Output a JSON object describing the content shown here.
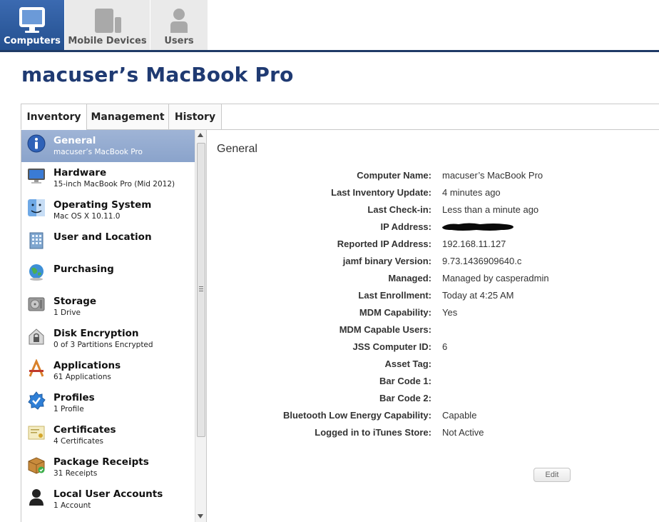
{
  "topnav": {
    "tabs": [
      {
        "label": "Computers",
        "icon": "monitor-icon",
        "active": true
      },
      {
        "label": "Mobile Devices",
        "icon": "mobile-devices-icon",
        "active": false
      },
      {
        "label": "Users",
        "icon": "user-icon",
        "active": false
      }
    ]
  },
  "page_title": "macuser’s MacBook Pro",
  "tabs": [
    {
      "label": "Inventory",
      "active": true
    },
    {
      "label": "Management",
      "active": false
    },
    {
      "label": "History",
      "active": false
    }
  ],
  "sidebar": {
    "items": [
      {
        "title": "General",
        "subtitle": "macuser’s MacBook Pro",
        "icon": "info-icon",
        "selected": true
      },
      {
        "title": "Hardware",
        "subtitle": "15-inch MacBook Pro (Mid 2012)",
        "icon": "display-icon"
      },
      {
        "title": "Operating System",
        "subtitle": "Mac OS X 10.11.0",
        "icon": "finder-icon"
      },
      {
        "title": "User and Location",
        "subtitle": "",
        "icon": "building-icon"
      },
      {
        "title": "Purchasing",
        "subtitle": "",
        "icon": "globe-icon"
      },
      {
        "title": "Storage",
        "subtitle": "1 Drive",
        "icon": "hard-drive-icon"
      },
      {
        "title": "Disk Encryption",
        "subtitle": "0 of 3 Partitions Encrypted",
        "icon": "lock-house-icon"
      },
      {
        "title": "Applications",
        "subtitle": "61 Applications",
        "icon": "applications-icon"
      },
      {
        "title": "Profiles",
        "subtitle": "1 Profile",
        "icon": "profile-badge-icon"
      },
      {
        "title": "Certificates",
        "subtitle": "4 Certificates",
        "icon": "certificate-icon"
      },
      {
        "title": "Package Receipts",
        "subtitle": "31 Receipts",
        "icon": "package-icon"
      },
      {
        "title": "Local User Accounts",
        "subtitle": "1 Account",
        "icon": "user-silhouette-icon"
      }
    ]
  },
  "section": {
    "title": "General"
  },
  "details": [
    {
      "label": "Computer Name:",
      "value": "macuser’s MacBook Pro"
    },
    {
      "label": "Last Inventory Update:",
      "value": "4 minutes ago"
    },
    {
      "label": "Last Check-in:",
      "value": "Less than a minute ago"
    },
    {
      "label": "IP Address:",
      "value": "",
      "redacted": true
    },
    {
      "label": "Reported IP Address:",
      "value": "192.168.11.127"
    },
    {
      "label": "jamf binary Version:",
      "value": "9.73.1436909640.c"
    },
    {
      "label": "Managed:",
      "value": "Managed by casperadmin"
    },
    {
      "label": "Last Enrollment:",
      "value": "Today at 4:25 AM"
    },
    {
      "label": "MDM Capability:",
      "value": "Yes"
    },
    {
      "label": "MDM Capable Users:",
      "value": ""
    },
    {
      "label": "JSS Computer ID:",
      "value": "6"
    },
    {
      "label": "Asset Tag:",
      "value": ""
    },
    {
      "label": "Bar Code 1:",
      "value": ""
    },
    {
      "label": "Bar Code 2:",
      "value": ""
    },
    {
      "label": "Bluetooth Low Energy Capability:",
      "value": "Capable"
    },
    {
      "label": "Logged in to iTunes Store:",
      "value": "Not Active"
    }
  ],
  "edit_button": "Edit",
  "colors": {
    "brand_blue": "#24508f",
    "title_blue": "#1f3a72",
    "selected_row": "#8aa3cb"
  }
}
